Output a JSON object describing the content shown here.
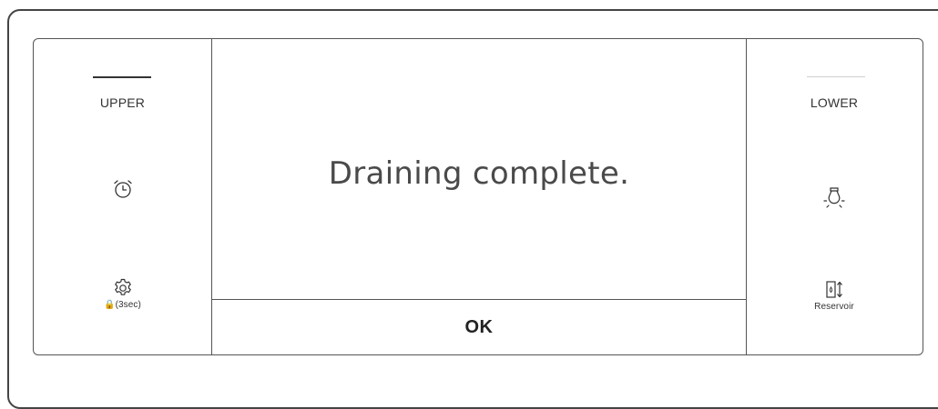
{
  "display": {
    "message": "Draining complete.",
    "ok_label": "OK"
  },
  "left_panel": {
    "upper_label": "UPPER",
    "timer_icon": "alarm-clock-icon",
    "settings_icon": "gear-icon",
    "lock_caption": "🔒(3sec)"
  },
  "right_panel": {
    "lower_label": "LOWER",
    "light_icon": "light-bulb-icon",
    "reservoir_icon": "reservoir-icon",
    "reservoir_caption": "Reservoir"
  },
  "colors": {
    "border": "#444444",
    "text": "#333333",
    "message_text": "#4a4a4a",
    "inactive_indicator": "#cfcfcf",
    "active_indicator": "#333333"
  }
}
